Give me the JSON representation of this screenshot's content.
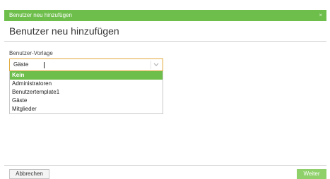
{
  "dialog": {
    "window_title": "Benutzer neu hinzufügen",
    "close_glyph": "×",
    "heading": "Benutzer neu hinzufügen"
  },
  "form": {
    "template_label": "Benutzer-Vorlage",
    "template_value": "Gäste",
    "options": [
      {
        "label": "Kein",
        "highlighted": true
      },
      {
        "label": "Administratoren",
        "highlighted": false
      },
      {
        "label": "Benutzertemplate1",
        "highlighted": false
      },
      {
        "label": "Gäste",
        "highlighted": false
      },
      {
        "label": "Mitglieder",
        "highlighted": false
      }
    ]
  },
  "footer": {
    "cancel_label": "Abbrechen",
    "next_label": "Weiter"
  },
  "colors": {
    "accent": "#6dbe4b",
    "focus_border": "#e0a93a"
  }
}
